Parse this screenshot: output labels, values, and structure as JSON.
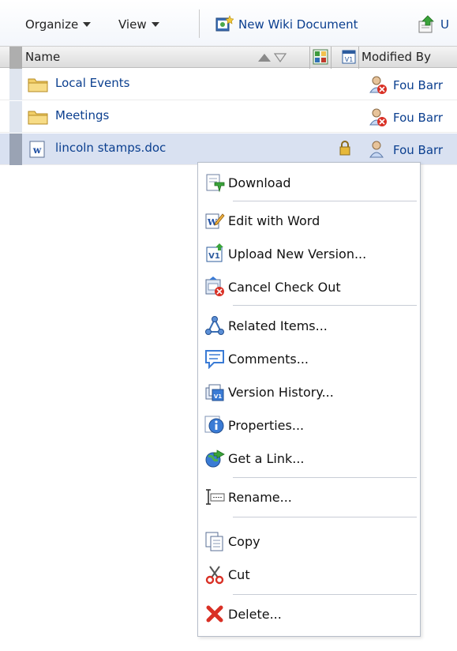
{
  "toolbar": {
    "organize_label": "Organize",
    "view_label": "View",
    "new_wiki_label": "New Wiki Document",
    "upload_label": "U"
  },
  "header": {
    "name_label": "Name",
    "modified_by_label": "Modified By"
  },
  "rows": [
    {
      "name": "Local Events",
      "icon": "folder-icon",
      "modified_by": "Fou Barr"
    },
    {
      "name": "Meetings",
      "icon": "folder-icon",
      "modified_by": "Fou Barr"
    },
    {
      "name": "lincoln stamps.doc",
      "icon": "word-doc-icon",
      "modified_by": "Fou Barr",
      "selected": true,
      "locked": true
    }
  ],
  "menu": {
    "items": [
      {
        "label": "Download",
        "icon": "download-icon"
      },
      {
        "label": "Edit with Word",
        "icon": "edit-word-icon"
      },
      {
        "label": "Upload New Version...",
        "icon": "upload-version-icon"
      },
      {
        "label": "Cancel Check Out",
        "icon": "cancel-checkout-icon"
      },
      {
        "label": "Related Items...",
        "icon": "related-items-icon"
      },
      {
        "label": "Comments...",
        "icon": "comments-icon"
      },
      {
        "label": "Version History...",
        "icon": "version-history-icon"
      },
      {
        "label": "Properties...",
        "icon": "properties-icon"
      },
      {
        "label": "Get a Link...",
        "icon": "get-link-icon"
      },
      {
        "label": "Rename...",
        "icon": "rename-icon"
      },
      {
        "label": "Copy",
        "icon": "copy-icon"
      },
      {
        "label": "Cut",
        "icon": "cut-icon"
      },
      {
        "label": "Delete...",
        "icon": "delete-icon"
      }
    ]
  },
  "colors": {
    "link": "#0b3f8f",
    "selected_row": "#d9e1f1",
    "menu_border": "#b6bdc9"
  }
}
